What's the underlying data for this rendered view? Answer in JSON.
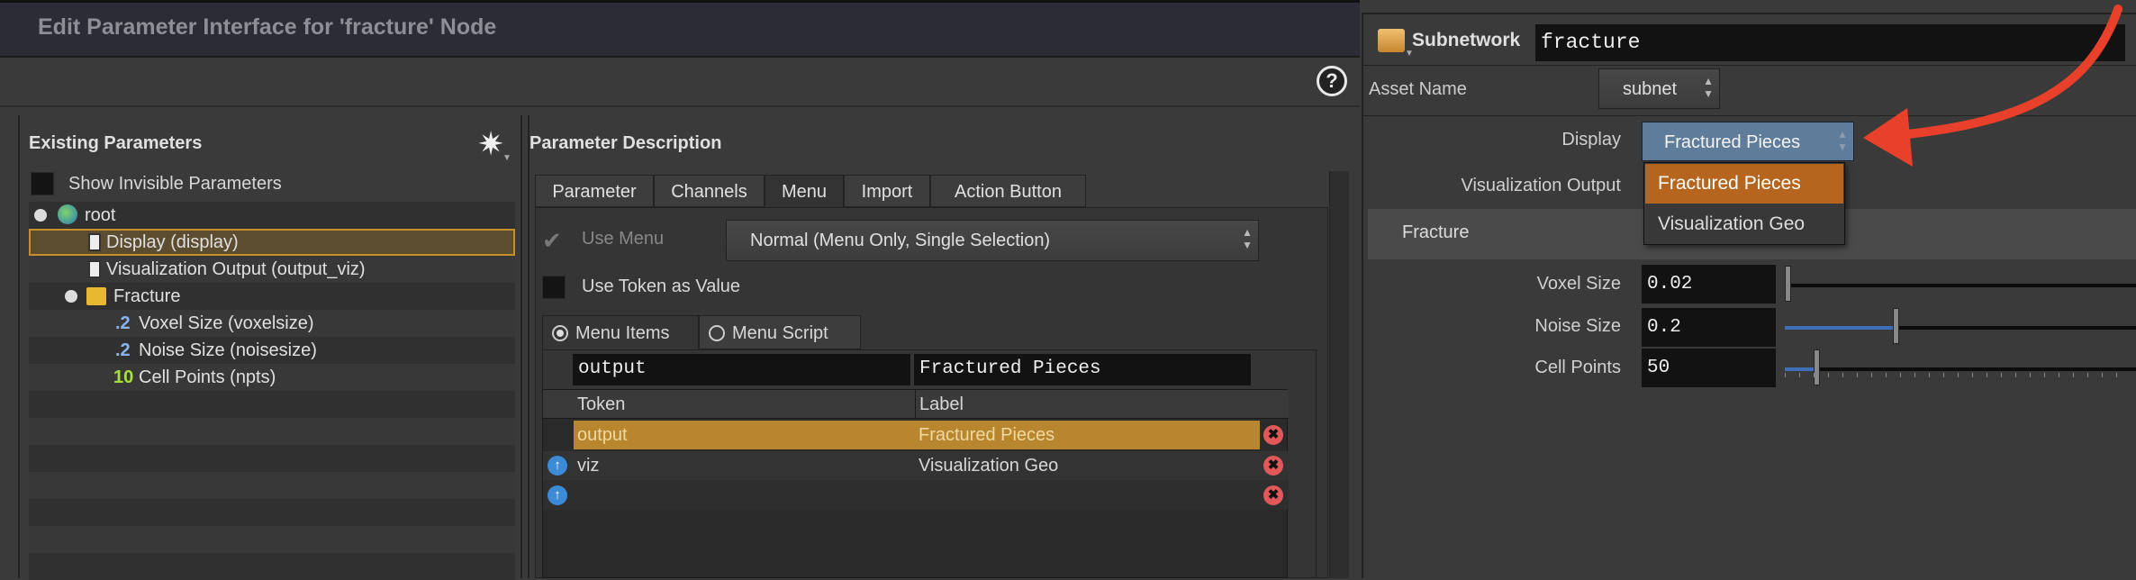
{
  "dialog": {
    "title": "Edit Parameter Interface for 'fracture' Node",
    "help_icon": "question-circle-icon",
    "existing_parameters": {
      "header": "Existing Parameters",
      "gear_icon": "gear-icon",
      "show_invisible_label": "Show Invisible Parameters",
      "show_invisible_checked": false,
      "tree": [
        {
          "label": "root",
          "icon": "globe-icon",
          "level": 0
        },
        {
          "label": "Display (display)",
          "icon": "menu-param-icon",
          "level": 1,
          "selected": true
        },
        {
          "label": "Visualization Output (output_viz)",
          "icon": "menu-param-icon",
          "level": 1
        },
        {
          "label": "Fracture",
          "icon": "folder-icon",
          "level": 1
        },
        {
          "label": "Voxel Size (voxelsize)",
          "icon": "float-param-icon",
          "icon_text": ".2",
          "level": 2
        },
        {
          "label": "Noise Size (noisesize)",
          "icon": "float-param-icon",
          "icon_text": ".2",
          "level": 2
        },
        {
          "label": "Cell Points (npts)",
          "icon": "int-param-icon",
          "icon_text": "10",
          "level": 2
        }
      ]
    },
    "parameter_description": {
      "header": "Parameter Description",
      "tabs": [
        "Parameter",
        "Channels",
        "Menu",
        "Import",
        "Action Button"
      ],
      "active_tab": "Menu",
      "use_menu_label": "Use Menu",
      "use_menu_checked": true,
      "menu_type": "Normal (Menu Only, Single Selection)",
      "use_token_label": "Use Token as Value",
      "use_token_checked": false,
      "menu_source_tabs": [
        "Menu Items",
        "Menu Script"
      ],
      "menu_source_selected": "Menu Items",
      "edit_token": "output",
      "edit_label": "Fractured Pieces",
      "columns": [
        "Token",
        "Label"
      ],
      "rows": [
        {
          "token": "output",
          "label": "Fractured Pieces",
          "selected": true
        },
        {
          "token": "viz",
          "label": "Visualization Geo"
        },
        {
          "token": "",
          "label": ""
        }
      ]
    }
  },
  "parameters_pane": {
    "node_type": "Subnetwork",
    "node_name": "fracture",
    "asset_name_label": "Asset Name",
    "asset_name_value": "subnet",
    "display_label": "Display",
    "display_value": "Fractured Pieces",
    "display_options": [
      "Fractured Pieces",
      "Visualization Geo"
    ],
    "display_highlighted": "Fractured Pieces",
    "viz_output_label": "Visualization Output",
    "folder_label": "Fracture",
    "params": [
      {
        "label": "Voxel Size",
        "value": "0.02",
        "slider_fraction": 0.0
      },
      {
        "label": "Noise Size",
        "value": "0.2",
        "slider_fraction": 0.3
      },
      {
        "label": "Cell Points",
        "value": "50",
        "slider_fraction": 0.08
      }
    ]
  },
  "colors": {
    "selection": "#b8862e",
    "popup_highlight": "#b5651d",
    "menu_button": "#5f7c9a",
    "annotation_arrow": "#e8402a"
  }
}
